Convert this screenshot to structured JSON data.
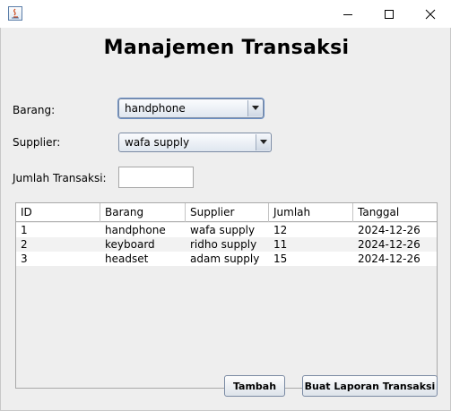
{
  "window": {
    "icons": {
      "app": "java-app-icon",
      "minimize": "minimize-icon",
      "maximize": "maximize-icon",
      "close": "close-icon"
    }
  },
  "page": {
    "title": "Manajemen Transaksi"
  },
  "form": {
    "barang_label": "Barang:",
    "barang_selected": "handphone",
    "supplier_label": "Supplier:",
    "supplier_selected": "wafa supply",
    "jumlah_label": "Jumlah Transaksi:",
    "jumlah_value": ""
  },
  "table": {
    "headers": [
      "ID",
      "Barang",
      "Supplier",
      "Jumlah",
      "Tanggal"
    ],
    "rows": [
      [
        "1",
        "handphone",
        "wafa supply",
        "12",
        "2024-12-26"
      ],
      [
        "2",
        "keyboard",
        "ridho supply",
        "11",
        "2024-12-26"
      ],
      [
        "3",
        "headset",
        "adam supply",
        "15",
        "2024-12-26"
      ]
    ]
  },
  "actions": {
    "tambah_label": "Tambah",
    "laporan_label": "Buat Laporan Transaksi"
  },
  "colors": {
    "background": "#eeeeee",
    "button_border": "#7a8aa3",
    "focus": "#6b8fc4"
  }
}
